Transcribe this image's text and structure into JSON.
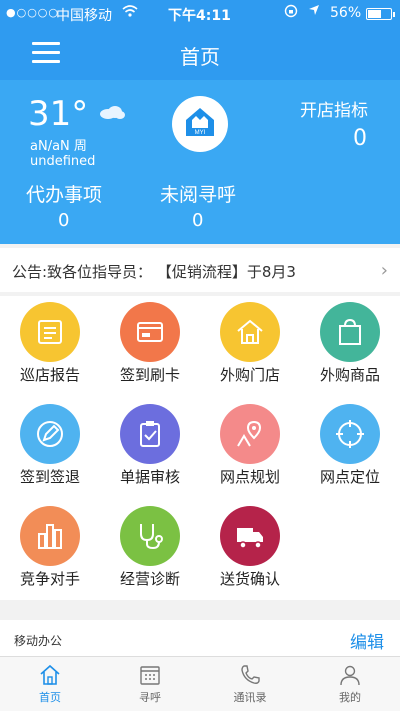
{
  "status_bar": {
    "signal": "●○○○○",
    "carrier": "中国移动",
    "time": "下午4:11",
    "battery": "56%"
  },
  "nav": {
    "title": "首页"
  },
  "hero": {
    "temperature": "31°",
    "weather_range": "aN/aN 周",
    "weather_desc": "undefined",
    "logo_text": "MYI",
    "open_store_label": "开店指标",
    "open_store_value": "0",
    "todo_label": "代办事项",
    "todo_value": "0",
    "unread_label": "未阅寻呼",
    "unread_value": "0"
  },
  "notice": {
    "text": "公告:致各位指导员：    【促销流程】于8月3",
    "arrow": "›"
  },
  "grid": {
    "items": [
      {
        "label": "巡店报告",
        "color": "#f7c531",
        "icon": "report-icon"
      },
      {
        "label": "签到刷卡",
        "color": "#f2774a",
        "icon": "card-icon"
      },
      {
        "label": "外购门店",
        "color": "#f7c531",
        "icon": "store-icon"
      },
      {
        "label": "外购商品",
        "color": "#43b59a",
        "icon": "bag-icon"
      },
      {
        "label": "签到签退",
        "color": "#4fb3f0",
        "icon": "pencil-icon"
      },
      {
        "label": "单据审核",
        "color": "#6c6ede",
        "icon": "clipboard-icon"
      },
      {
        "label": "网点规划",
        "color": "#f48a8a",
        "icon": "map-pin-icon"
      },
      {
        "label": "网点定位",
        "color": "#4fb3f0",
        "icon": "target-icon"
      },
      {
        "label": "竞争对手",
        "color": "#f28d57",
        "icon": "buildings-icon"
      },
      {
        "label": "经营诊断",
        "color": "#7bc143",
        "icon": "stethoscope-icon"
      },
      {
        "label": "送货确认",
        "color": "#b5234a",
        "icon": "truck-icon"
      }
    ]
  },
  "office": {
    "title": "移动办公",
    "edit_label": "编辑"
  },
  "tabbar": {
    "tabs": [
      {
        "label": "首页",
        "icon": "home-icon"
      },
      {
        "label": "寻呼",
        "icon": "calendar-icon"
      },
      {
        "label": "通讯录",
        "icon": "phone-icon"
      },
      {
        "label": "我的",
        "icon": "user-icon"
      }
    ]
  },
  "colors": {
    "primary": "#2f9bf0",
    "hero": "#3aa8f3",
    "tab_active": "#1e8fe8"
  }
}
